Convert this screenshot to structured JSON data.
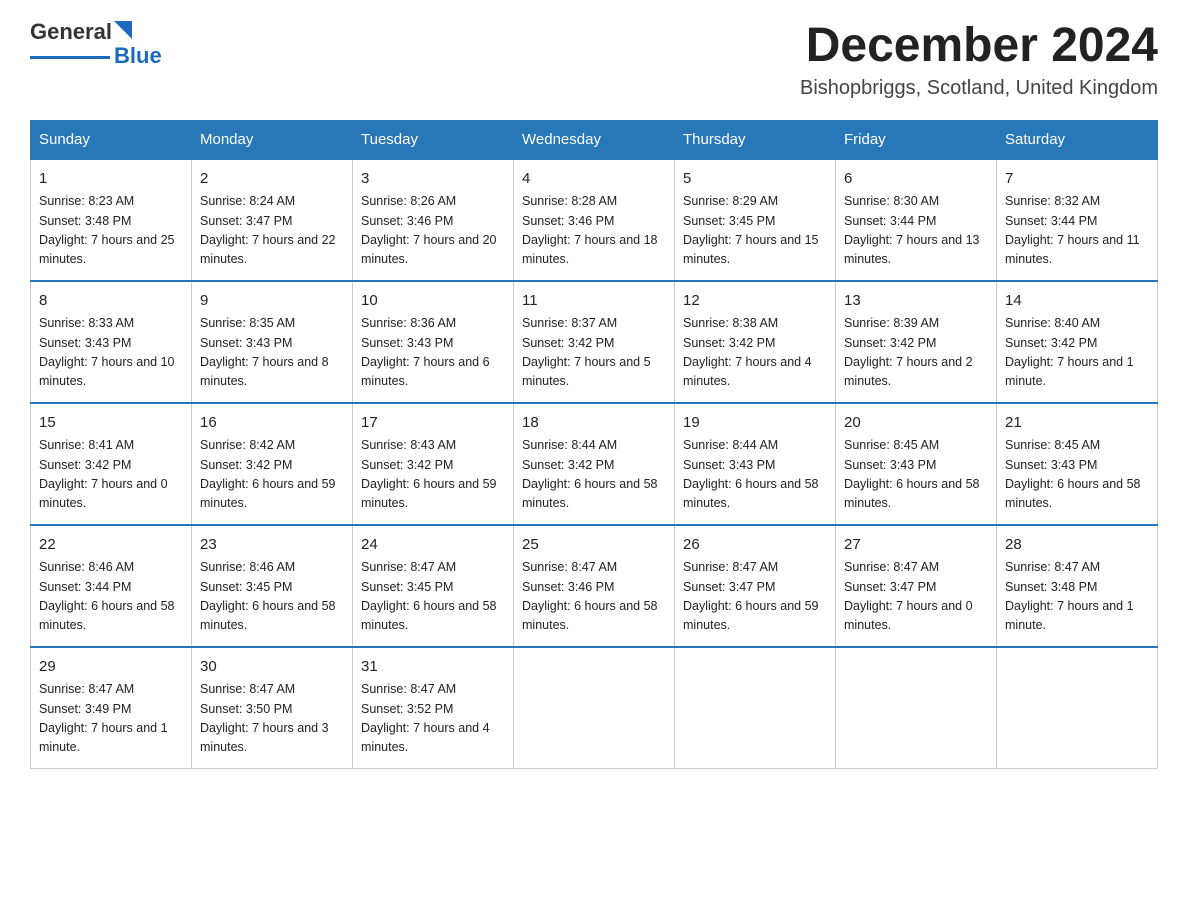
{
  "header": {
    "logo_general": "General",
    "logo_blue": "Blue",
    "month_title": "December 2024",
    "location": "Bishopbriggs, Scotland, United Kingdom"
  },
  "weekdays": [
    "Sunday",
    "Monday",
    "Tuesday",
    "Wednesday",
    "Thursday",
    "Friday",
    "Saturday"
  ],
  "weeks": [
    [
      {
        "day": "1",
        "sunrise": "8:23 AM",
        "sunset": "3:48 PM",
        "daylight": "7 hours and 25 minutes."
      },
      {
        "day": "2",
        "sunrise": "8:24 AM",
        "sunset": "3:47 PM",
        "daylight": "7 hours and 22 minutes."
      },
      {
        "day": "3",
        "sunrise": "8:26 AM",
        "sunset": "3:46 PM",
        "daylight": "7 hours and 20 minutes."
      },
      {
        "day": "4",
        "sunrise": "8:28 AM",
        "sunset": "3:46 PM",
        "daylight": "7 hours and 18 minutes."
      },
      {
        "day": "5",
        "sunrise": "8:29 AM",
        "sunset": "3:45 PM",
        "daylight": "7 hours and 15 minutes."
      },
      {
        "day": "6",
        "sunrise": "8:30 AM",
        "sunset": "3:44 PM",
        "daylight": "7 hours and 13 minutes."
      },
      {
        "day": "7",
        "sunrise": "8:32 AM",
        "sunset": "3:44 PM",
        "daylight": "7 hours and 11 minutes."
      }
    ],
    [
      {
        "day": "8",
        "sunrise": "8:33 AM",
        "sunset": "3:43 PM",
        "daylight": "7 hours and 10 minutes."
      },
      {
        "day": "9",
        "sunrise": "8:35 AM",
        "sunset": "3:43 PM",
        "daylight": "7 hours and 8 minutes."
      },
      {
        "day": "10",
        "sunrise": "8:36 AM",
        "sunset": "3:43 PM",
        "daylight": "7 hours and 6 minutes."
      },
      {
        "day": "11",
        "sunrise": "8:37 AM",
        "sunset": "3:42 PM",
        "daylight": "7 hours and 5 minutes."
      },
      {
        "day": "12",
        "sunrise": "8:38 AM",
        "sunset": "3:42 PM",
        "daylight": "7 hours and 4 minutes."
      },
      {
        "day": "13",
        "sunrise": "8:39 AM",
        "sunset": "3:42 PM",
        "daylight": "7 hours and 2 minutes."
      },
      {
        "day": "14",
        "sunrise": "8:40 AM",
        "sunset": "3:42 PM",
        "daylight": "7 hours and 1 minute."
      }
    ],
    [
      {
        "day": "15",
        "sunrise": "8:41 AM",
        "sunset": "3:42 PM",
        "daylight": "7 hours and 0 minutes."
      },
      {
        "day": "16",
        "sunrise": "8:42 AM",
        "sunset": "3:42 PM",
        "daylight": "6 hours and 59 minutes."
      },
      {
        "day": "17",
        "sunrise": "8:43 AM",
        "sunset": "3:42 PM",
        "daylight": "6 hours and 59 minutes."
      },
      {
        "day": "18",
        "sunrise": "8:44 AM",
        "sunset": "3:42 PM",
        "daylight": "6 hours and 58 minutes."
      },
      {
        "day": "19",
        "sunrise": "8:44 AM",
        "sunset": "3:43 PM",
        "daylight": "6 hours and 58 minutes."
      },
      {
        "day": "20",
        "sunrise": "8:45 AM",
        "sunset": "3:43 PM",
        "daylight": "6 hours and 58 minutes."
      },
      {
        "day": "21",
        "sunrise": "8:45 AM",
        "sunset": "3:43 PM",
        "daylight": "6 hours and 58 minutes."
      }
    ],
    [
      {
        "day": "22",
        "sunrise": "8:46 AM",
        "sunset": "3:44 PM",
        "daylight": "6 hours and 58 minutes."
      },
      {
        "day": "23",
        "sunrise": "8:46 AM",
        "sunset": "3:45 PM",
        "daylight": "6 hours and 58 minutes."
      },
      {
        "day": "24",
        "sunrise": "8:47 AM",
        "sunset": "3:45 PM",
        "daylight": "6 hours and 58 minutes."
      },
      {
        "day": "25",
        "sunrise": "8:47 AM",
        "sunset": "3:46 PM",
        "daylight": "6 hours and 58 minutes."
      },
      {
        "day": "26",
        "sunrise": "8:47 AM",
        "sunset": "3:47 PM",
        "daylight": "6 hours and 59 minutes."
      },
      {
        "day": "27",
        "sunrise": "8:47 AM",
        "sunset": "3:47 PM",
        "daylight": "7 hours and 0 minutes."
      },
      {
        "day": "28",
        "sunrise": "8:47 AM",
        "sunset": "3:48 PM",
        "daylight": "7 hours and 1 minute."
      }
    ],
    [
      {
        "day": "29",
        "sunrise": "8:47 AM",
        "sunset": "3:49 PM",
        "daylight": "7 hours and 1 minute."
      },
      {
        "day": "30",
        "sunrise": "8:47 AM",
        "sunset": "3:50 PM",
        "daylight": "7 hours and 3 minutes."
      },
      {
        "day": "31",
        "sunrise": "8:47 AM",
        "sunset": "3:52 PM",
        "daylight": "7 hours and 4 minutes."
      },
      null,
      null,
      null,
      null
    ]
  ]
}
